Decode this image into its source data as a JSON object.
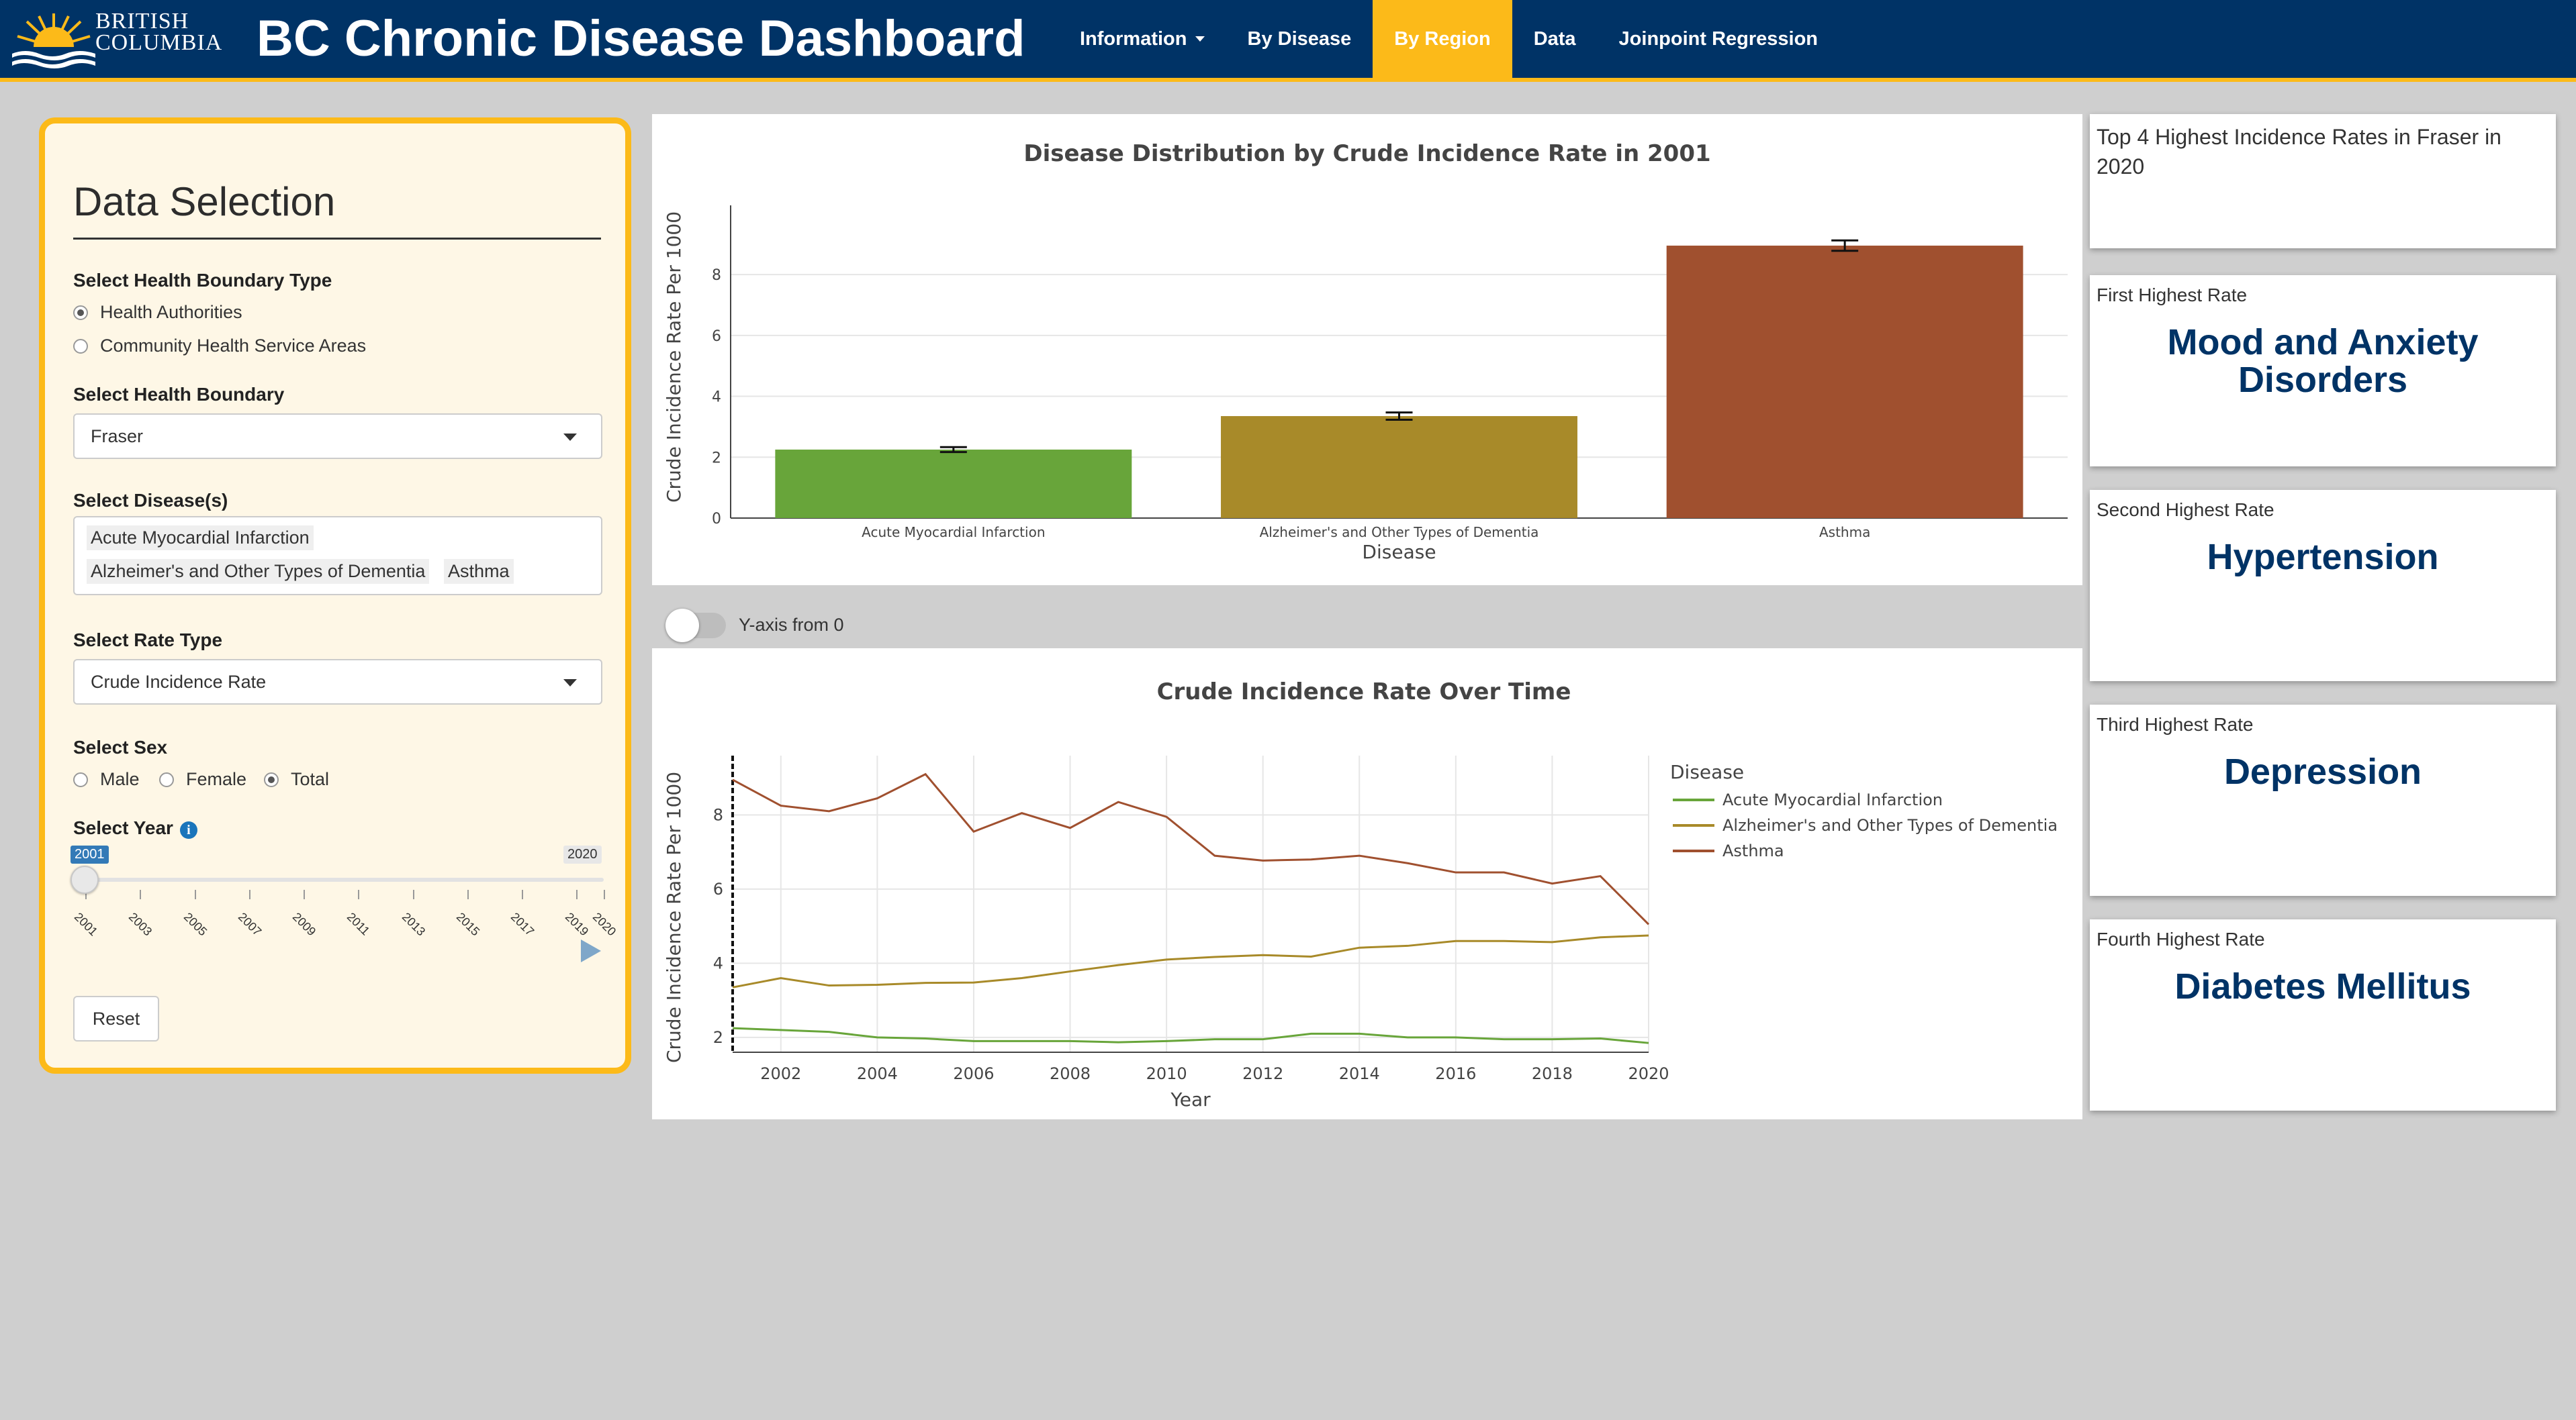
{
  "header": {
    "logo_line1": "BRITISH",
    "logo_line2": "COLUMBIA",
    "title": "BC Chronic Disease Dashboard",
    "nav": [
      {
        "label": "Information",
        "dropdown": true,
        "active": false
      },
      {
        "label": "By Disease",
        "active": false
      },
      {
        "label": "By Region",
        "active": true
      },
      {
        "label": "Data",
        "active": false
      },
      {
        "label": "Joinpoint Regression",
        "active": false
      }
    ]
  },
  "sidebar": {
    "title": "Data Selection",
    "boundary_type_label": "Select Health Boundary Type",
    "boundary_types": [
      "Health Authorities",
      "Community Health Service Areas"
    ],
    "boundary_type_selected": "Health Authorities",
    "boundary_label": "Select Health Boundary",
    "boundary_value": "Fraser",
    "disease_label": "Select Disease(s)",
    "diseases": [
      "Acute Myocardial Infarction",
      "Alzheimer's and Other Types of Dementia",
      "Asthma"
    ],
    "rate_type_label": "Select Rate Type",
    "rate_type_value": "Crude Incidence Rate",
    "sex_label": "Select Sex",
    "sex_options": [
      "Male",
      "Female",
      "Total"
    ],
    "sex_selected": "Total",
    "year_label": "Select Year",
    "year_value": "2001",
    "year_max": "2020",
    "year_ticks": [
      "2001",
      "2003",
      "2005",
      "2007",
      "2009",
      "2011",
      "2013",
      "2015",
      "2017",
      "2019",
      "2020"
    ],
    "reset_label": "Reset"
  },
  "toggle": {
    "label": "Y-axis from 0",
    "on": false
  },
  "colors": {
    "ami": "#68a53a",
    "alz": "#a88a29",
    "asthma": "#a0502f",
    "navy": "#003366",
    "gold": "#fcba19"
  },
  "chart_data": [
    {
      "type": "bar",
      "title": "Disease Distribution by Crude Incidence Rate in 2001",
      "xlabel": "Disease",
      "ylabel": "Crude Incidence Rate Per 1000",
      "categories": [
        "Acute Myocardial Infarction",
        "Alzheimer's and Other Types of Dementia",
        "Asthma"
      ],
      "values": [
        2.25,
        3.35,
        8.95
      ],
      "error": [
        0.08,
        0.12,
        0.17
      ],
      "ylim": [
        0,
        9.7
      ],
      "yticks": [
        "0",
        "2",
        "4",
        "6",
        "8"
      ],
      "grid": true
    },
    {
      "type": "line",
      "title": "Crude Incidence Rate Over Time",
      "xlabel": "Year",
      "ylabel": "Crude Incidence Rate Per 1000",
      "legend_title": "Disease",
      "legend_position": "right",
      "x": [
        2001,
        2002,
        2003,
        2004,
        2005,
        2006,
        2007,
        2008,
        2009,
        2010,
        2011,
        2012,
        2013,
        2014,
        2015,
        2016,
        2017,
        2018,
        2019,
        2020
      ],
      "xticks": [
        "2002",
        "2004",
        "2006",
        "2008",
        "2010",
        "2012",
        "2014",
        "2016",
        "2018",
        "2020"
      ],
      "yticks": [
        "2",
        "4",
        "6",
        "8"
      ],
      "xlim": [
        2001,
        2020
      ],
      "ylim": [
        1.6,
        9.6
      ],
      "series": [
        {
          "name": "Acute Myocardial Infarction",
          "values": [
            2.25,
            2.2,
            2.15,
            2.0,
            1.97,
            1.9,
            1.9,
            1.9,
            1.87,
            1.9,
            1.95,
            1.95,
            2.1,
            2.1,
            2.0,
            2.0,
            1.95,
            1.95,
            1.97,
            1.85
          ]
        },
        {
          "name": "Alzheimer's and Other Types of Dementia",
          "values": [
            3.35,
            3.6,
            3.4,
            3.42,
            3.47,
            3.48,
            3.6,
            3.78,
            3.95,
            4.1,
            4.17,
            4.22,
            4.18,
            4.42,
            4.47,
            4.6,
            4.6,
            4.57,
            4.7,
            4.75
          ]
        },
        {
          "name": "Asthma",
          "values": [
            8.95,
            8.25,
            8.1,
            8.45,
            9.1,
            7.55,
            8.05,
            7.65,
            8.35,
            7.95,
            6.9,
            6.77,
            6.8,
            6.9,
            6.7,
            6.45,
            6.45,
            6.15,
            6.35,
            5.05
          ]
        }
      ]
    }
  ],
  "cards": {
    "top_title": "Top 4 Highest Incidence Rates in Fraser in 2020",
    "items": [
      {
        "header": "First Highest Rate",
        "value": "Mood and Anxiety Disorders"
      },
      {
        "header": "Second Highest Rate",
        "value": "Hypertension"
      },
      {
        "header": "Third Highest Rate",
        "value": "Depression"
      },
      {
        "header": "Fourth Highest Rate",
        "value": "Diabetes Mellitus"
      }
    ]
  }
}
